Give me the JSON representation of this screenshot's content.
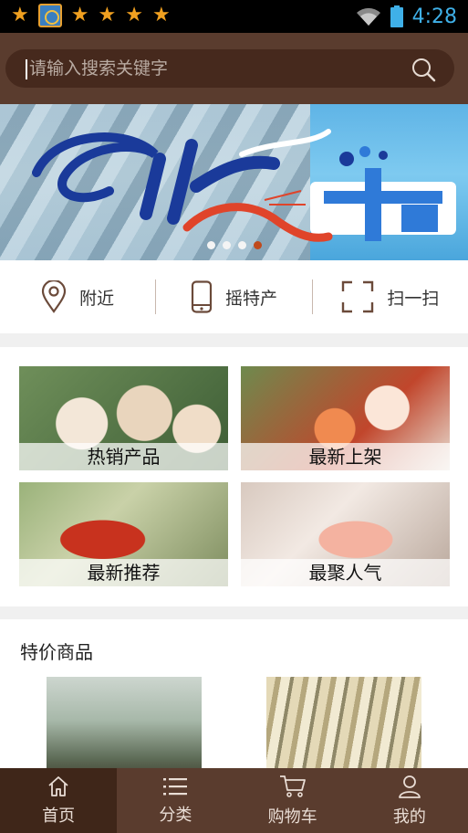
{
  "status_bar": {
    "time": "4:28"
  },
  "search": {
    "placeholder": "请输入搜索关键字"
  },
  "banner": {
    "slides": 4,
    "active_slide": 4
  },
  "quick_actions": [
    {
      "label": "附近",
      "icon": "location-pin-icon"
    },
    {
      "label": "摇特产",
      "icon": "phone-icon"
    },
    {
      "label": "扫一扫",
      "icon": "scan-icon"
    }
  ],
  "categories": [
    {
      "label": "热销产品"
    },
    {
      "label": "最新上架"
    },
    {
      "label": "最新推荐"
    },
    {
      "label": "最聚人气"
    }
  ],
  "special": {
    "title": "特价商品"
  },
  "nav": [
    {
      "label": "首页",
      "icon": "home-icon",
      "active": true
    },
    {
      "label": "分类",
      "icon": "list-icon",
      "active": false
    },
    {
      "label": "购物车",
      "icon": "cart-icon",
      "active": false
    },
    {
      "label": "我的",
      "icon": "user-icon",
      "active": false
    }
  ],
  "colors": {
    "brown": "#5a3c2e",
    "dark_brown": "#3f2619",
    "clock_blue": "#3fb0e8",
    "star_orange": "#f0a020"
  }
}
